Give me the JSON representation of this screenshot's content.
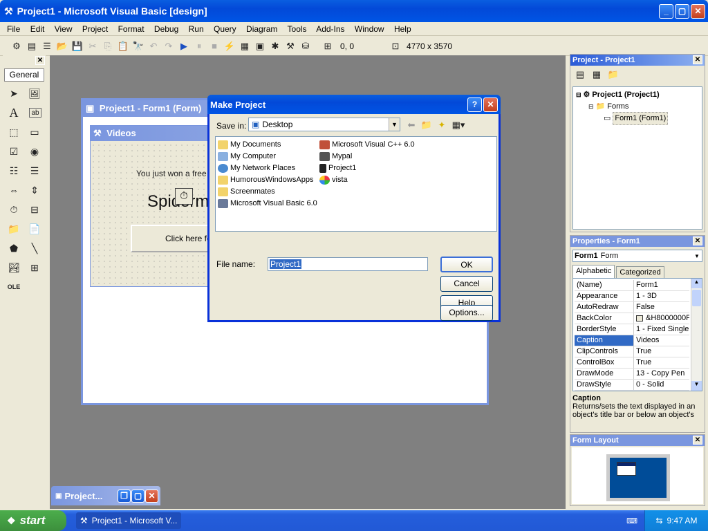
{
  "window": {
    "title": "Project1 - Microsoft Visual Basic [design]"
  },
  "menu": [
    "File",
    "Edit",
    "View",
    "Project",
    "Format",
    "Debug",
    "Run",
    "Query",
    "Diagram",
    "Tools",
    "Add-Ins",
    "Window",
    "Help"
  ],
  "toolbar": {
    "position": "0, 0",
    "size": "4770 x 3570"
  },
  "toolbox": {
    "tab": "General"
  },
  "form_window": {
    "title": "Project1 - Form1 (Form)",
    "form_caption": "Videos",
    "label_text": "You just won a free m",
    "big_text": "Spiderm",
    "button_text": "Click here for"
  },
  "dialog": {
    "title": "Make Project",
    "help_btn": "?",
    "save_in_label": "Save in:",
    "save_in_value": "Desktop",
    "files_col1": [
      "My Documents",
      "My Computer",
      "My Network Places",
      "HumorousWindowsApps",
      "Screenmates",
      "Microsoft Visual Basic 6.0"
    ],
    "files_col2": [
      "Microsoft Visual C++ 6.0",
      "Mypal",
      "Project1",
      "vista"
    ],
    "filename_label": "File name:",
    "filename_value": "Project1",
    "ok": "OK",
    "cancel": "Cancel",
    "help": "Help",
    "options": "Options..."
  },
  "project_panel": {
    "title": "Project - Project1",
    "tree": {
      "root": "Project1 (Project1)",
      "folder": "Forms",
      "item": "Form1 (Form1)"
    }
  },
  "properties_panel": {
    "title": "Properties - Form1",
    "object_name": "Form1",
    "object_type": "Form",
    "tabs": [
      "Alphabetic",
      "Categorized"
    ],
    "rows": [
      {
        "name": "(Name)",
        "value": "Form1"
      },
      {
        "name": "Appearance",
        "value": "1 - 3D"
      },
      {
        "name": "AutoRedraw",
        "value": "False"
      },
      {
        "name": "BackColor",
        "value": "&H8000000F"
      },
      {
        "name": "BorderStyle",
        "value": "1 - Fixed Single"
      },
      {
        "name": "Caption",
        "value": "Videos"
      },
      {
        "name": "ClipControls",
        "value": "True"
      },
      {
        "name": "ControlBox",
        "value": "True"
      },
      {
        "name": "DrawMode",
        "value": "13 - Copy Pen"
      },
      {
        "name": "DrawStyle",
        "value": "0 - Solid"
      }
    ],
    "desc_title": "Caption",
    "desc_text": "Returns/sets the text displayed in an object's title bar or below an object's"
  },
  "form_layout": {
    "title": "Form Layout"
  },
  "minimized": {
    "title": "Project..."
  },
  "taskbar": {
    "start": "start",
    "task": "Project1 - Microsoft V...",
    "clock": "9:47 AM"
  }
}
